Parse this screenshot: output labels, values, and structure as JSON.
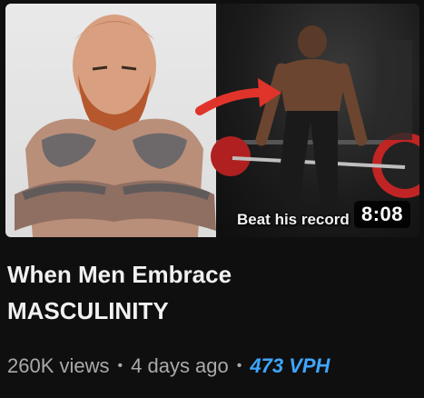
{
  "video": {
    "title_line1": "When Men Embrace",
    "title_line2": "MASCULINITY",
    "duration": "8:08",
    "thumbnail_overlay_text": "Beat his record",
    "views": "260K views",
    "age": "4 days ago",
    "vph": "473 VPH",
    "separator": "•"
  },
  "colors": {
    "background": "#0f0f0f",
    "title": "#f1f1f1",
    "meta": "#aaaaaa",
    "vph": "#3ea6ff",
    "arrow": "#e0342b"
  }
}
